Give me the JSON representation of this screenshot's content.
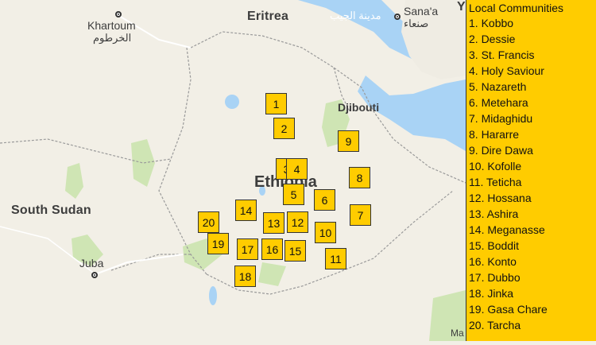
{
  "map": {
    "places": {
      "eritrea": "Eritrea",
      "khartoum": "Khartoum",
      "khartoum_ar": "الخرطوم",
      "sanaa": "Sana'a",
      "sanaa_ar": "صنعاء",
      "red_sea_city_ar": "مدينة الجيب",
      "djibouti": "Djibouti",
      "ethiopia": "Ethiopia",
      "south_sudan": "South Sudan",
      "juba": "Juba",
      "edge_y": "Y",
      "edge_ma": "Ma"
    },
    "markers": [
      "1",
      "2",
      "3",
      "4",
      "5",
      "6",
      "7",
      "8",
      "9",
      "10",
      "11",
      "12",
      "13",
      "14",
      "15",
      "16",
      "17",
      "18",
      "19",
      "20"
    ]
  },
  "legend": {
    "title": "Local Communities",
    "items": [
      "1. Kobbo",
      "2. Dessie",
      "3. St. Francis",
      "4. Holy Saviour",
      "5. Nazareth",
      "6. Metehara",
      "7. Midaghidu",
      "8. Hararre",
      "9. Dire Dawa",
      "10. Kofolle",
      "11. Teticha",
      "12. Hossana",
      "13. Ashira",
      "14. Meganasse",
      "15. Boddit",
      "16. Konto",
      "17. Dubbo",
      "18. Jinka",
      "19. Gasa Chare",
      "20. Tarcha"
    ]
  },
  "colors": {
    "marker_fill": "#ffcc00",
    "legend_bg": "#ffcc00",
    "water": "#a9d3f5",
    "land": "#f2efe6",
    "green": "#cfe5b4",
    "border": "#9a9a9a"
  }
}
